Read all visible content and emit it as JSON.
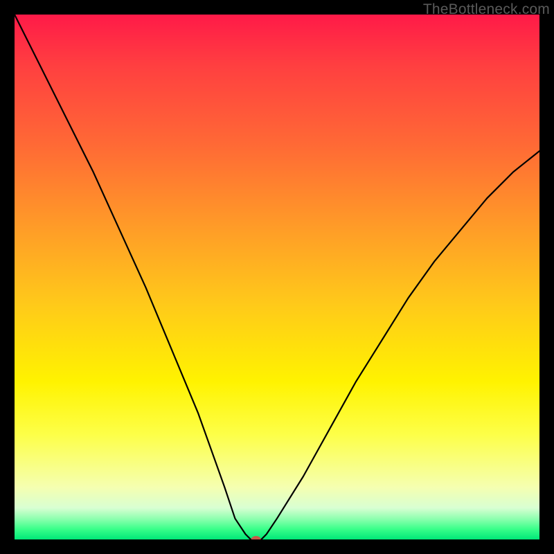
{
  "watermark": "TheBottleneck.com",
  "chart_data": {
    "type": "line",
    "title": "",
    "xlabel": "",
    "ylabel": "",
    "xlim": [
      0,
      100
    ],
    "ylim": [
      0,
      100
    ],
    "series": [
      {
        "name": "bottleneck-curve",
        "x": [
          0,
          5,
          10,
          15,
          20,
          25,
          30,
          35,
          40,
          42,
          44,
          45,
          47,
          48,
          50,
          55,
          60,
          65,
          70,
          75,
          80,
          85,
          90,
          95,
          100
        ],
        "values": [
          100,
          90,
          80,
          70,
          59,
          48,
          36,
          24,
          10,
          4,
          1,
          0,
          0,
          1,
          4,
          12,
          21,
          30,
          38,
          46,
          53,
          59,
          65,
          70,
          74
        ]
      }
    ],
    "marker": {
      "x": 46,
      "y": 0,
      "color": "#c85a4a"
    },
    "background_gradient": [
      {
        "stop": 0.0,
        "color": "#ff1a48"
      },
      {
        "stop": 0.7,
        "color": "#fff300"
      },
      {
        "stop": 1.0,
        "color": "#00e878"
      }
    ]
  }
}
